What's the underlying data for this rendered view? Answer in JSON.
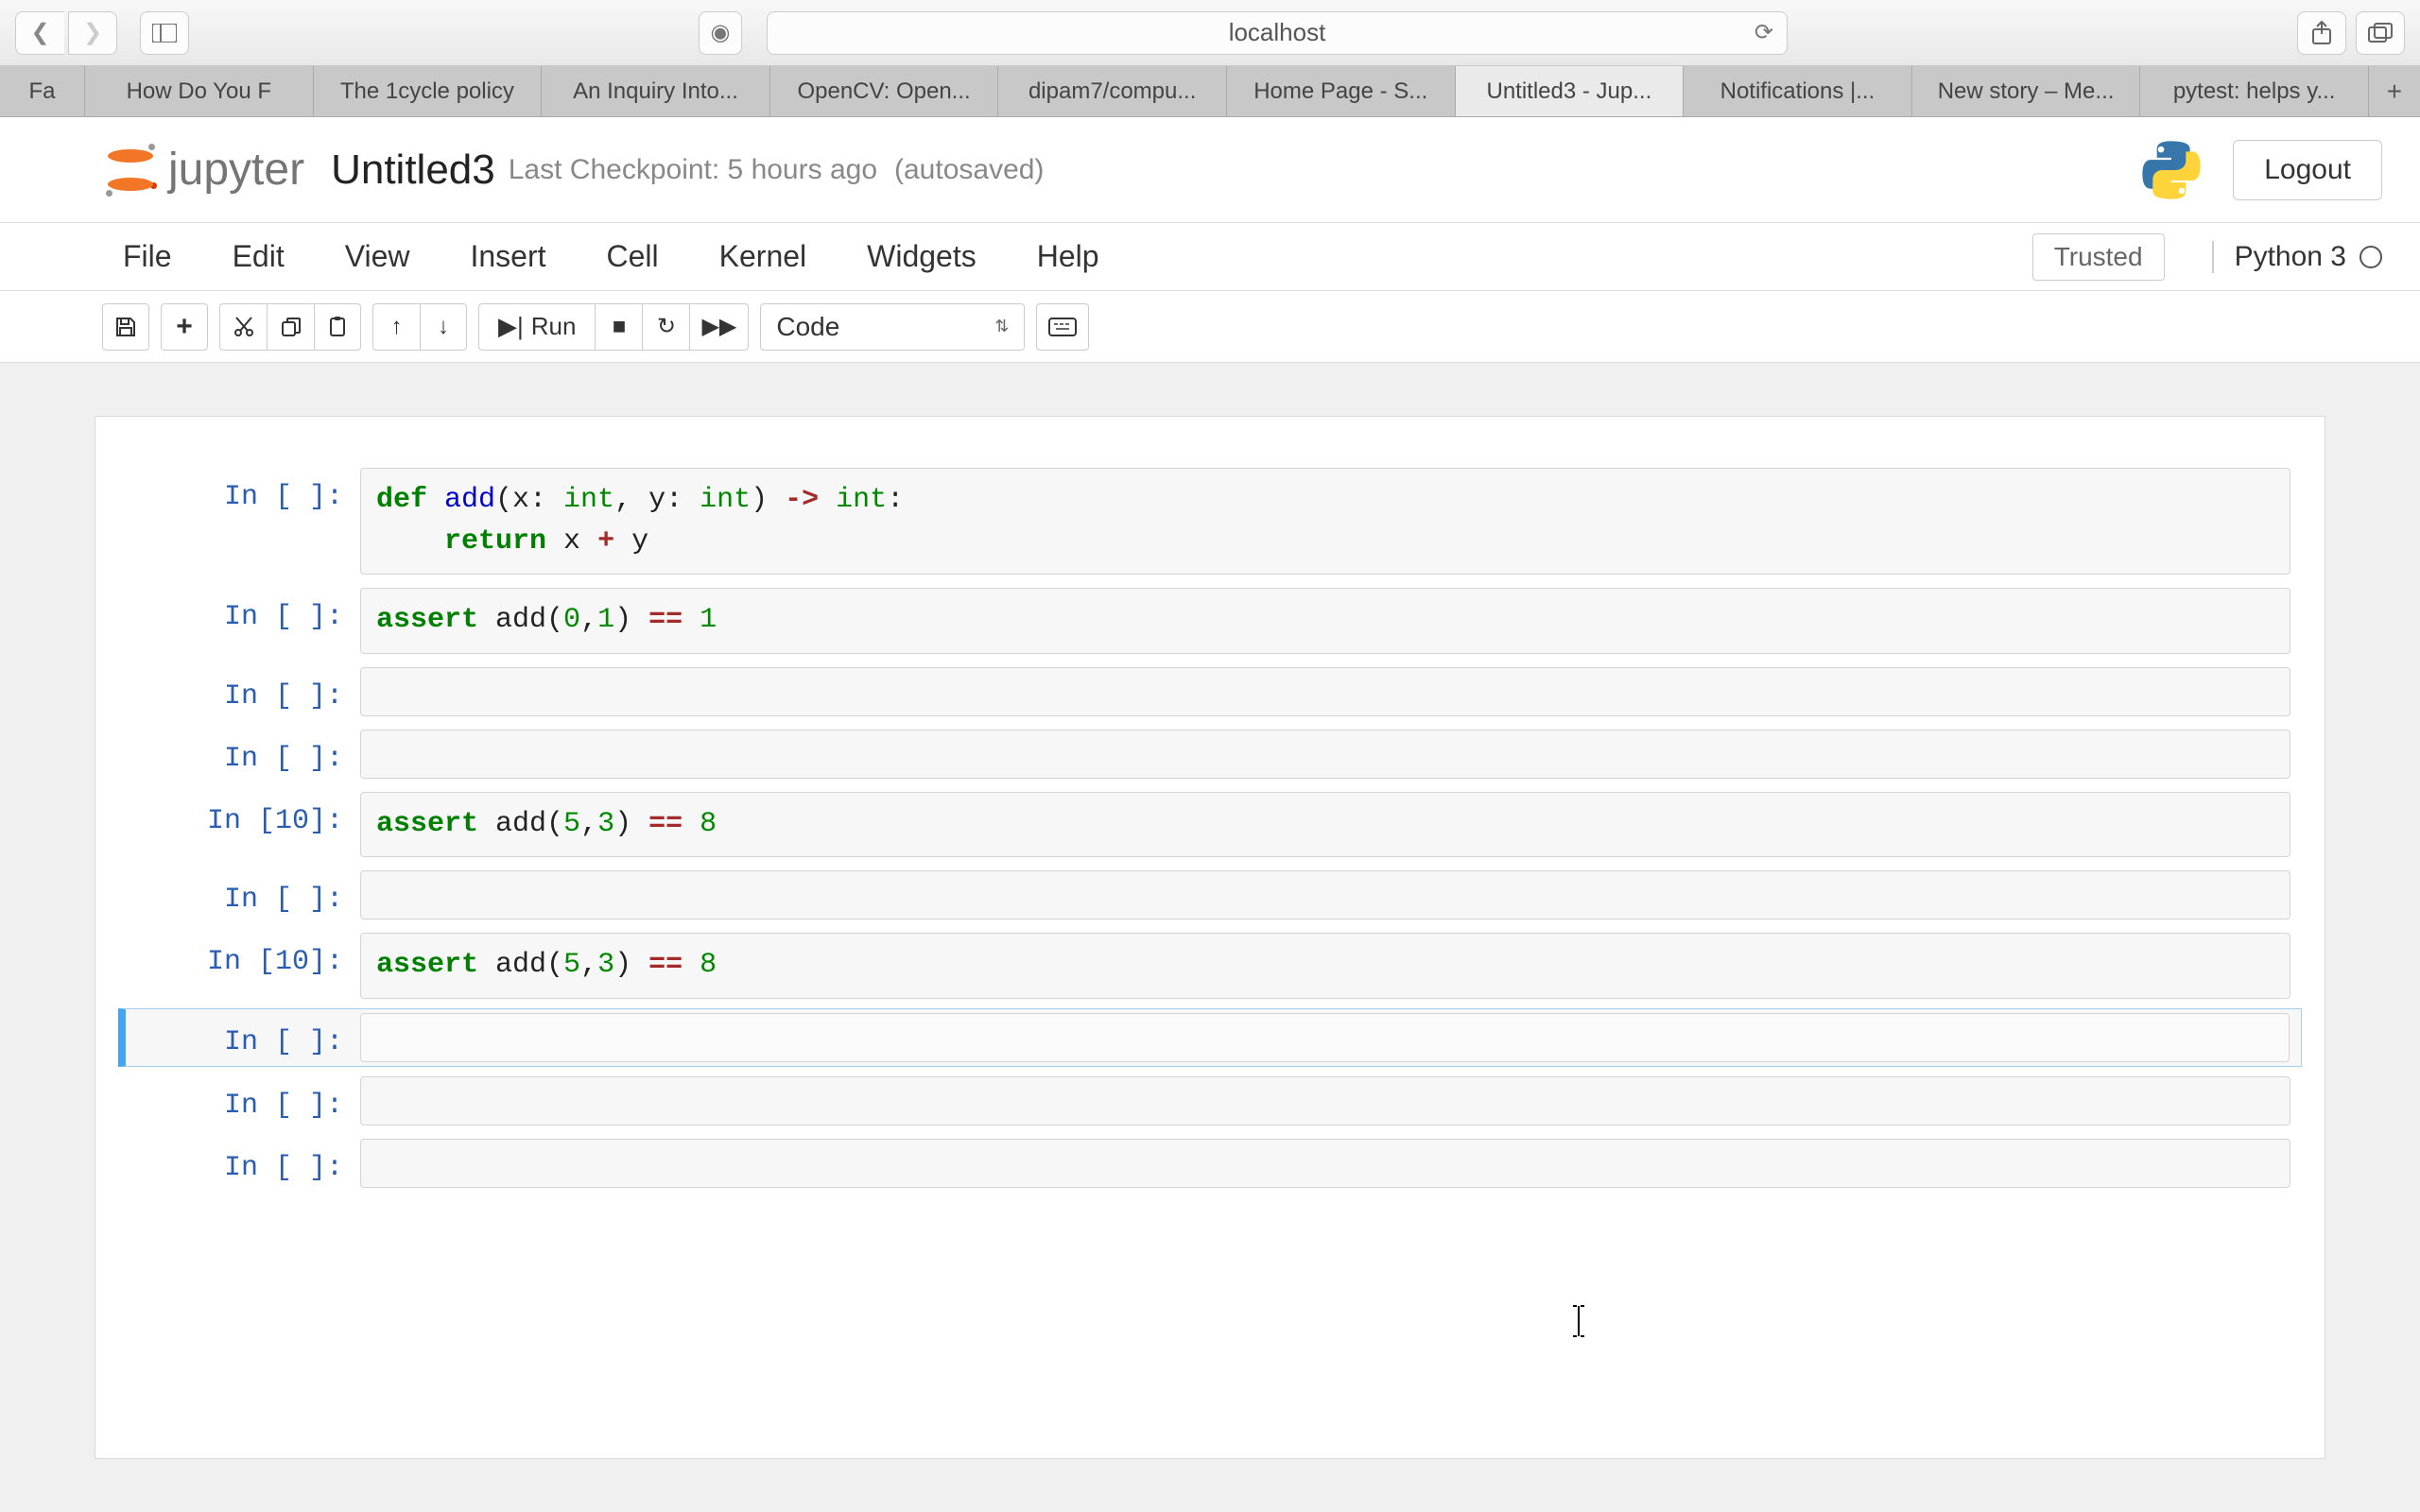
{
  "browser": {
    "url": "localhost",
    "tabs": [
      "Fa",
      "How Do You F",
      "The 1cycle policy",
      "An Inquiry Into...",
      "OpenCV: Open...",
      "dipam7/compu...",
      "Home Page - S...",
      "Untitled3 - Jup...",
      "Notifications |...",
      "New story – Me...",
      "pytest: helps y..."
    ],
    "active_tab_index": 7
  },
  "header": {
    "logo_text": "jupyter",
    "title": "Untitled3",
    "checkpoint": "Last Checkpoint: 5 hours ago",
    "autosave": "(autosaved)",
    "logout": "Logout"
  },
  "menubar": {
    "items": [
      "File",
      "Edit",
      "View",
      "Insert",
      "Cell",
      "Kernel",
      "Widgets",
      "Help"
    ],
    "trusted": "Trusted",
    "kernel": "Python 3"
  },
  "toolbar": {
    "run_label": "Run",
    "cell_type": "Code"
  },
  "cells": [
    {
      "prompt": "In [ ]:",
      "tokens": [
        [
          "kw",
          "def "
        ],
        [
          "fn",
          "add"
        ],
        [
          "pn",
          "(x: "
        ],
        [
          "ty",
          "int"
        ],
        [
          "pn",
          ", y: "
        ],
        [
          "ty",
          "int"
        ],
        [
          "pn",
          ") "
        ],
        [
          "op",
          "->"
        ],
        [
          "pn",
          " "
        ],
        [
          "ty",
          "int"
        ],
        [
          "pn",
          ":"
        ],
        [
          "nl",
          ""
        ],
        [
          "pn",
          "    "
        ],
        [
          "kw",
          "return"
        ],
        [
          "pn",
          " x "
        ],
        [
          "op",
          "+"
        ],
        [
          "pn",
          " y"
        ]
      ]
    },
    {
      "prompt": "In [ ]:",
      "tokens": [
        [
          "kw",
          "assert"
        ],
        [
          "pn",
          " add("
        ],
        [
          "num",
          "0"
        ],
        [
          "pn",
          ","
        ],
        [
          "num",
          "1"
        ],
        [
          "pn",
          ") "
        ],
        [
          "op",
          "=="
        ],
        [
          "pn",
          " "
        ],
        [
          "num",
          "1"
        ]
      ]
    },
    {
      "prompt": "In [ ]:",
      "tokens": []
    },
    {
      "prompt": "In [ ]:",
      "tokens": []
    },
    {
      "prompt": "In [10]:",
      "tokens": [
        [
          "kw",
          "assert"
        ],
        [
          "pn",
          " add("
        ],
        [
          "num",
          "5"
        ],
        [
          "pn",
          ","
        ],
        [
          "num",
          "3"
        ],
        [
          "pn",
          ") "
        ],
        [
          "op",
          "=="
        ],
        [
          "pn",
          " "
        ],
        [
          "num",
          "8"
        ]
      ]
    },
    {
      "prompt": "In [ ]:",
      "tokens": []
    },
    {
      "prompt": "In [10]:",
      "tokens": [
        [
          "kw",
          "assert"
        ],
        [
          "pn",
          " add("
        ],
        [
          "num",
          "5"
        ],
        [
          "pn",
          ","
        ],
        [
          "num",
          "3"
        ],
        [
          "pn",
          ") "
        ],
        [
          "op",
          "=="
        ],
        [
          "pn",
          " "
        ],
        [
          "num",
          "8"
        ]
      ]
    },
    {
      "prompt": "In [ ]:",
      "tokens": [],
      "selected": true
    },
    {
      "prompt": "In [ ]:",
      "tokens": []
    },
    {
      "prompt": "In [ ]:",
      "tokens": []
    }
  ]
}
